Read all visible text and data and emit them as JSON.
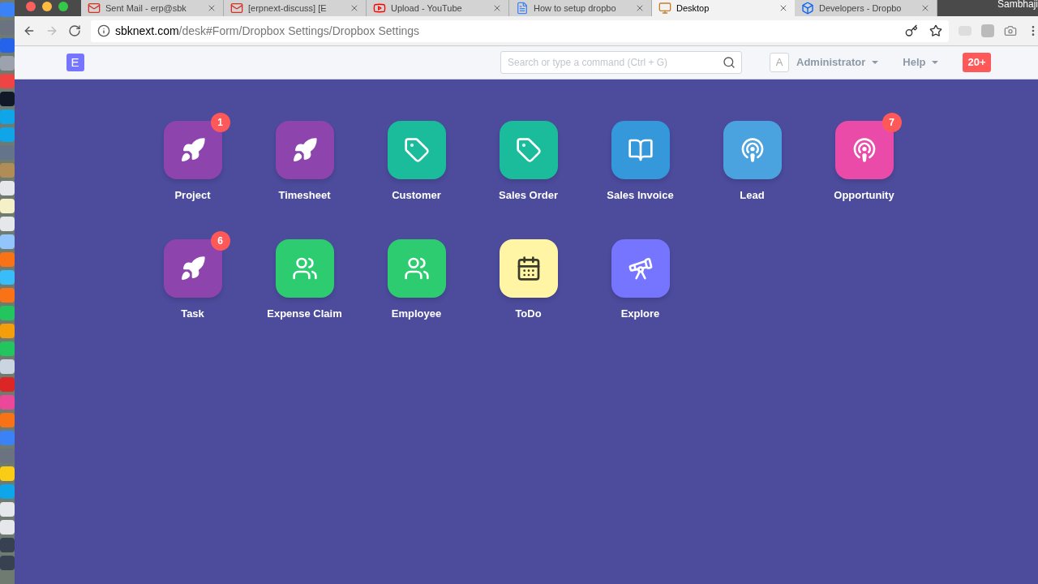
{
  "browser": {
    "tabs": [
      {
        "kind": "gmail",
        "title": "Sent Mail - erp@sbk",
        "selected": false
      },
      {
        "kind": "gmail",
        "title": "[erpnext-discuss] [E",
        "selected": false
      },
      {
        "kind": "youtube",
        "title": "Upload - YouTube",
        "selected": false
      },
      {
        "kind": "docs",
        "title": "How to setup dropbo",
        "selected": false
      },
      {
        "kind": "desk",
        "title": "Desktop",
        "selected": true
      },
      {
        "kind": "dropbox",
        "title": "Developers - Dropbo",
        "selected": false
      }
    ],
    "profile": "Sambhaji",
    "url": {
      "host": "sbknext.com",
      "path": "/desk#Form/Dropbox Settings/Dropbox Settings"
    }
  },
  "navbar": {
    "logo": "E",
    "search": {
      "placeholder": "Search or type a command (Ctrl + G)"
    },
    "avatar": "A",
    "user": "Administrator",
    "help": "Help",
    "notifications": "20+"
  },
  "modules": [
    {
      "label": "Project",
      "kind": "rocket",
      "color": "#8e44ad",
      "badge": "1"
    },
    {
      "label": "Timesheet",
      "kind": "rocket",
      "color": "#8e44ad"
    },
    {
      "label": "Customer",
      "kind": "tag",
      "color": "#1abc9c"
    },
    {
      "label": "Sales Order",
      "kind": "tag",
      "color": "#1abc9c"
    },
    {
      "label": "Sales Invoice",
      "kind": "book",
      "color": "#3498db"
    },
    {
      "label": "Lead",
      "kind": "podcast",
      "color": "#4aa3df"
    },
    {
      "label": "Opportunity",
      "kind": "podcast",
      "color": "#ea4ba8",
      "badge": "7"
    },
    {
      "label": "Task",
      "kind": "rocket",
      "color": "#8e44ad",
      "badge": "6"
    },
    {
      "label": "Expense Claim",
      "kind": "users",
      "color": "#2ecc71"
    },
    {
      "label": "Employee",
      "kind": "users",
      "color": "#2ecc71"
    },
    {
      "label": "ToDo",
      "kind": "calendar",
      "color": "#fff5a5"
    },
    {
      "label": "Explore",
      "kind": "telescope",
      "color": "#7575ff"
    }
  ]
}
